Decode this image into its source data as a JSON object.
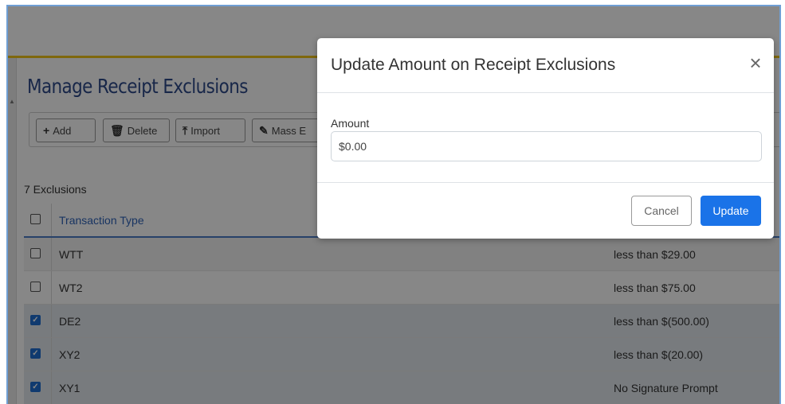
{
  "page": {
    "title": "Manage Receipt Exclusions",
    "toolbar": {
      "add": "Add",
      "delete": "Delete",
      "import": "Import",
      "mass_edit": "Mass E"
    },
    "count_text": "7 Exclusions",
    "table": {
      "header": "Transaction Type",
      "rows": [
        {
          "type": "WTT",
          "value": "less than $29.00",
          "checked": false
        },
        {
          "type": "WT2",
          "value": "less than $75.00",
          "checked": false
        },
        {
          "type": "DE2",
          "value": "less than $(500.00)",
          "checked": true
        },
        {
          "type": "XY2",
          "value": "less than $(20.00)",
          "checked": true
        },
        {
          "type": "XY1",
          "value": "No Signature Prompt",
          "checked": true
        }
      ]
    }
  },
  "modal": {
    "title": "Update Amount on Receipt Exclusions",
    "close_icon": "×",
    "amount_label": "Amount",
    "amount_value": "$0.00",
    "cancel_label": "Cancel",
    "update_label": "Update"
  },
  "icons": {
    "add": "plus-icon",
    "delete": "trash-icon",
    "import": "upload-icon",
    "mass_edit": "edit-icon",
    "check": "checkmark-icon"
  },
  "colors": {
    "accent": "#1a73e8",
    "header_link": "#2f63b9",
    "title": "#2f4a8a",
    "gold_bar": "#f0c419"
  }
}
